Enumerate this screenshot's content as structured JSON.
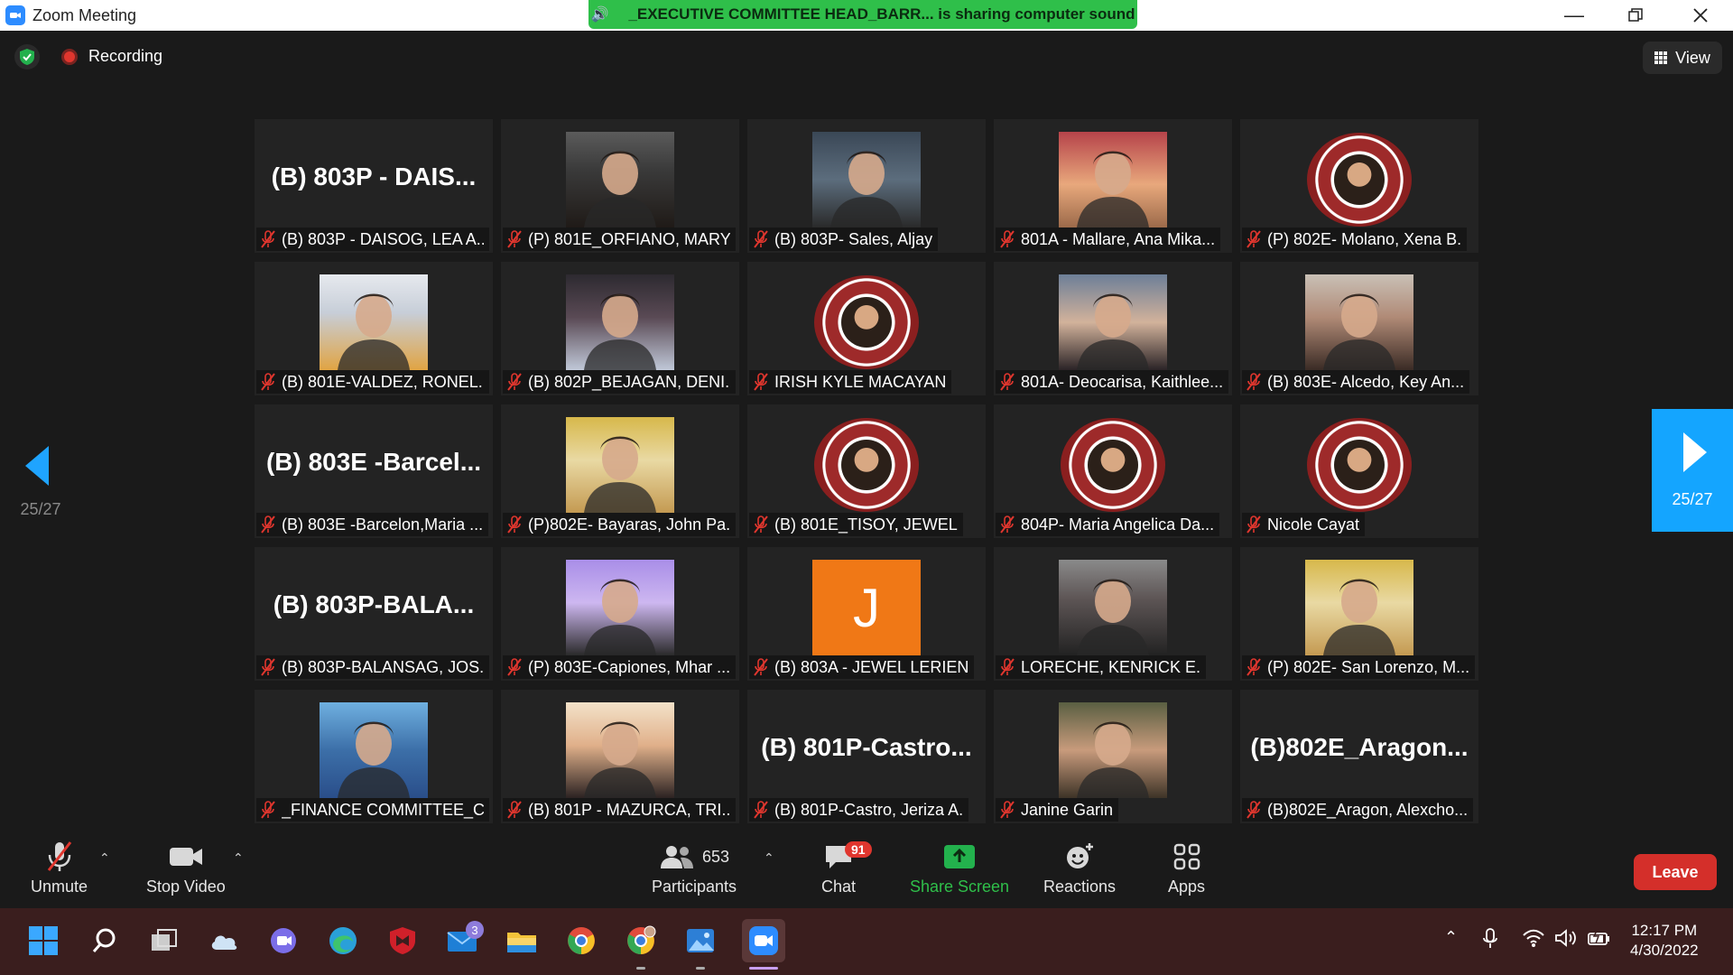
{
  "window": {
    "title": "Zoom Meeting"
  },
  "sharing_banner": "_EXECUTIVE COMMITTEE HEAD_BARR... is sharing computer sound",
  "status": {
    "recording": "Recording"
  },
  "view_label": "View",
  "pagination": {
    "left": "25/27",
    "right": "25/27"
  },
  "tiles": [
    {
      "label": "(B) 803P - DAISOG, LEA A...",
      "big": "(B) 803P - DAIS...",
      "photo": "none"
    },
    {
      "label": "(P) 801E_ORFIANO, MARY...",
      "big": "",
      "photo": "photo-a"
    },
    {
      "label": "(B) 803P- Sales, Aljay",
      "big": "",
      "photo": "photo-b"
    },
    {
      "label": "801A - Mallare, Ana Mika...",
      "big": "",
      "photo": "photo-c"
    },
    {
      "label": "(P) 802E- Molano, Xena B.",
      "big": "",
      "photo": "seal"
    },
    {
      "label": "(B) 801E-VALDEZ, RONEL...",
      "big": "",
      "photo": "photo-d"
    },
    {
      "label": "(B) 802P_BEJAGAN, DENI...",
      "big": "",
      "photo": "photo-e"
    },
    {
      "label": "IRISH KYLE MACAYAN",
      "big": "",
      "photo": "seal"
    },
    {
      "label": "801A- Deocarisa, Kaithlee...",
      "big": "",
      "photo": "photo-f"
    },
    {
      "label": "(B) 803E- Alcedo, Key An...",
      "big": "",
      "photo": "photo-g"
    },
    {
      "label": "(B) 803E -Barcelon,Maria ...",
      "big": "(B) 803E -Barcel...",
      "photo": "none"
    },
    {
      "label": "(P)802E- Bayaras, John Pa...",
      "big": "",
      "photo": "photo-h"
    },
    {
      "label": "(B) 801E_TISOY, JEWEL",
      "big": "",
      "photo": "seal"
    },
    {
      "label": "804P- Maria Angelica Da...",
      "big": "",
      "photo": "seal"
    },
    {
      "label": "Nicole Cayat",
      "big": "",
      "photo": "seal"
    },
    {
      "label": "(B) 803P-BALANSAG, JOS...",
      "big": "(B) 803P-BALA...",
      "photo": "none"
    },
    {
      "label": "(P) 803E-Capiones, Mhar ...",
      "big": "",
      "photo": "photo-i"
    },
    {
      "label": "(B) 803A - JEWEL LERIEN",
      "big": "",
      "photo": "avatar-j",
      "initial": "J"
    },
    {
      "label": "LORECHE, KENRICK E.",
      "big": "",
      "photo": "photo-k"
    },
    {
      "label": "(P) 802E- San Lorenzo, M...",
      "big": "",
      "photo": "photo-h"
    },
    {
      "label": "_FINANCE COMMITTEE_C...",
      "big": "",
      "photo": "photo-l"
    },
    {
      "label": "(B) 801P - MAZURCA, TRI...",
      "big": "",
      "photo": "photo-m"
    },
    {
      "label": "(B) 801P-Castro, Jeriza A.",
      "big": "(B) 801P-Castro...",
      "photo": "none"
    },
    {
      "label": "Janine Garin",
      "big": "",
      "photo": "photo-n"
    },
    {
      "label": "(B)802E_Aragon, Alexcho...",
      "big": "(B)802E_Aragon...",
      "photo": "none"
    }
  ],
  "toolbar": {
    "unmute": "Unmute",
    "stop_video": "Stop Video",
    "participants_count": "653",
    "participants": "Participants",
    "chat": "Chat",
    "chat_badge": "91",
    "share_screen": "Share Screen",
    "reactions": "Reactions",
    "apps": "Apps",
    "leave": "Leave"
  },
  "taskbar": {
    "mail_badge": "3",
    "time": "12:17 PM",
    "date": "4/30/2022"
  },
  "colors": {
    "accent": "#14a5ff",
    "share_green": "#2fbf4a",
    "leave_red": "#d42f2a"
  }
}
